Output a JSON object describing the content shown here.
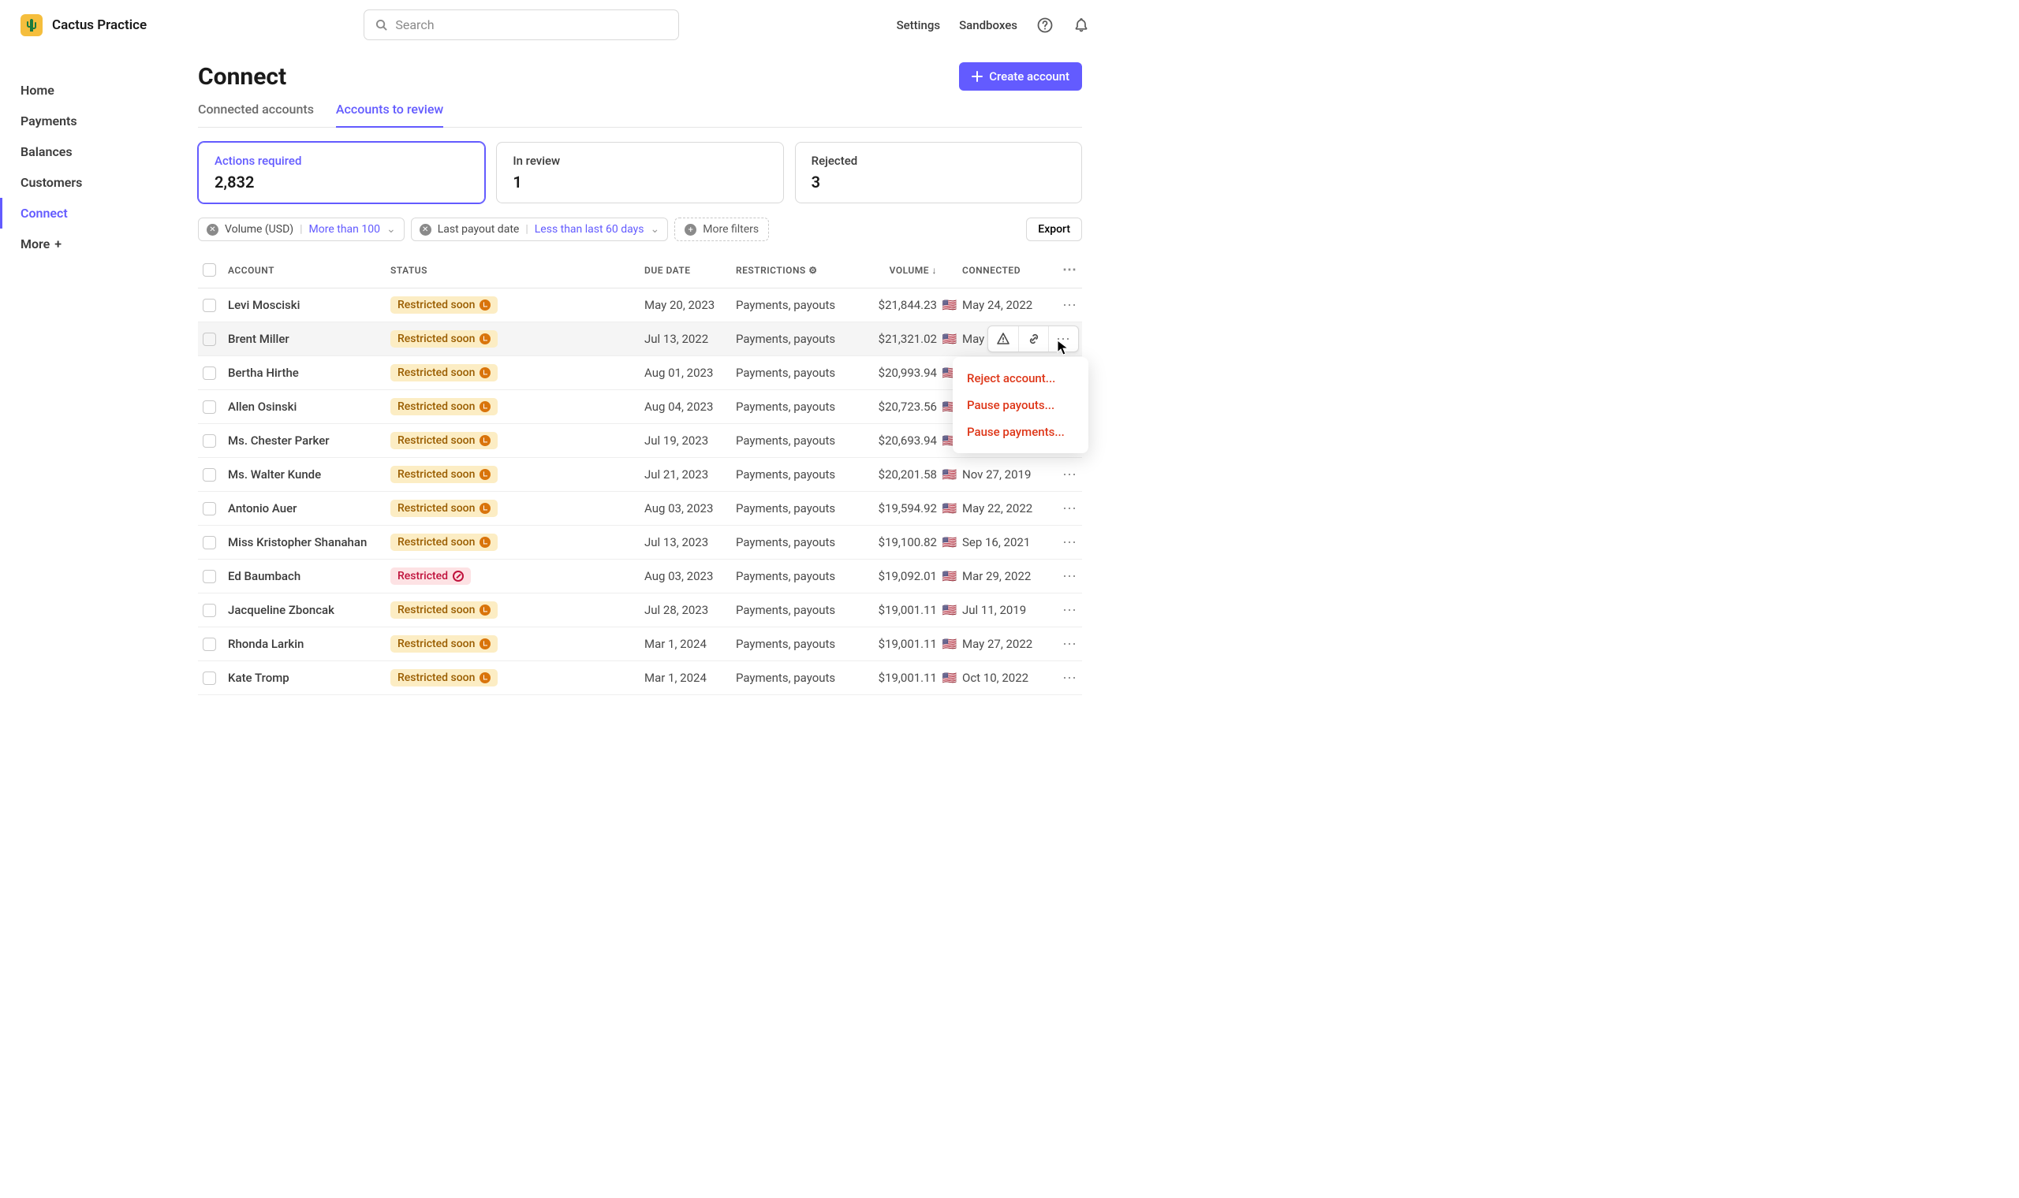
{
  "brand": {
    "name": "Cactus Practice"
  },
  "search": {
    "placeholder": "Search"
  },
  "top_links": {
    "settings": "Settings",
    "sandboxes": "Sandboxes"
  },
  "nav": {
    "items": [
      "Home",
      "Payments",
      "Balances",
      "Customers",
      "Connect"
    ],
    "more": "More"
  },
  "page": {
    "title": "Connect",
    "create": "Create account"
  },
  "tabs": {
    "connected": "Connected accounts",
    "review": "Accounts to review"
  },
  "stats": [
    {
      "label": "Actions required",
      "value": "2,832"
    },
    {
      "label": "In review",
      "value": "1"
    },
    {
      "label": "Rejected",
      "value": "3"
    }
  ],
  "filters": {
    "volume": {
      "field": "Volume (USD)",
      "value": "More than 100"
    },
    "payout": {
      "field": "Last payout date",
      "value": "Less than last 60 days"
    },
    "more": "More filters",
    "export": "Export"
  },
  "columns": {
    "account": "ACCOUNT",
    "status": "STATUS",
    "due": "DUE DATE",
    "restrictions": "RESTRICTIONS",
    "volume": "VOLUME",
    "connected": "CONNECTED"
  },
  "status_labels": {
    "soon": "Restricted soon",
    "restricted": "Restricted"
  },
  "rows": [
    {
      "name": "Levi Mosciski",
      "status": "soon",
      "due": "May 20, 2023",
      "restr": "Payments, payouts",
      "vol": "$21,844.23",
      "conn": "May 24, 2022"
    },
    {
      "name": "Brent Miller",
      "status": "soon",
      "due": "Jul 13, 2022",
      "restr": "Payments, payouts",
      "vol": "$21,321.02",
      "conn": "May"
    },
    {
      "name": "Bertha Hirthe",
      "status": "soon",
      "due": "Aug 01, 2023",
      "restr": "Payments, payouts",
      "vol": "$20,993.94",
      "conn": ""
    },
    {
      "name": "Allen Osinski",
      "status": "soon",
      "due": "Aug 04, 2023",
      "restr": "Payments, payouts",
      "vol": "$20,723.56",
      "conn": ""
    },
    {
      "name": "Ms. Chester Parker",
      "status": "soon",
      "due": "Jul 19, 2023",
      "restr": "Payments, payouts",
      "vol": "$20,693.94",
      "conn": ""
    },
    {
      "name": "Ms. Walter Kunde",
      "status": "soon",
      "due": "Jul 21, 2023",
      "restr": "Payments, payouts",
      "vol": "$20,201.58",
      "conn": "Nov 27, 2019"
    },
    {
      "name": "Antonio Auer",
      "status": "soon",
      "due": "Aug 03, 2023",
      "restr": "Payments, payouts",
      "vol": "$19,594.92",
      "conn": "May 22, 2022"
    },
    {
      "name": "Miss Kristopher Shanahan",
      "status": "soon",
      "due": "Jul 13, 2023",
      "restr": "Payments, payouts",
      "vol": "$19,100.82",
      "conn": "Sep 16, 2021"
    },
    {
      "name": "Ed Baumbach",
      "status": "restricted",
      "due": "Aug 03, 2023",
      "restr": "Payments, payouts",
      "vol": "$19,092.01",
      "conn": "Mar 29, 2022"
    },
    {
      "name": "Jacqueline Zboncak",
      "status": "soon",
      "due": "Jul 28, 2023",
      "restr": "Payments, payouts",
      "vol": "$19,001.11",
      "conn": "Jul 11, 2019"
    },
    {
      "name": "Rhonda Larkin",
      "status": "soon",
      "due": "Mar 1, 2024",
      "restr": "Payments, payouts",
      "vol": "$19,001.11",
      "conn": "May 27, 2022"
    },
    {
      "name": "Kate Tromp",
      "status": "soon",
      "due": "Mar 1, 2024",
      "restr": "Payments, payouts",
      "vol": "$19,001.11",
      "conn": "Oct 10, 2022"
    }
  ],
  "menu": {
    "reject": "Reject account...",
    "pause_payouts": "Pause payouts...",
    "pause_payments": "Pause payments..."
  }
}
